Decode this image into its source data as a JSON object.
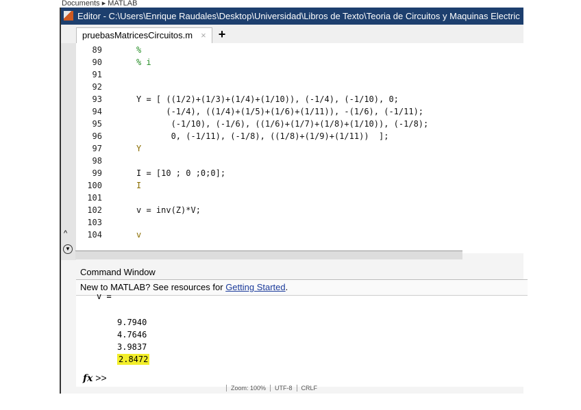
{
  "breadcrumb": [
    "Documents",
    "MATLAB"
  ],
  "title": "Editor - C:\\Users\\Enrique Raudales\\Desktop\\Universidad\\Libros de Texto\\Teoria de Circuitos y Maquinas Electric",
  "tab": {
    "label": "pruebasMatricesCircuitos.m",
    "close": "×",
    "add": "+"
  },
  "editor": {
    "lines": [
      {
        "n": "89",
        "text": "%",
        "kind": "comment"
      },
      {
        "n": "90",
        "text": "% i",
        "kind": "comment"
      },
      {
        "n": "91",
        "text": ""
      },
      {
        "n": "92",
        "text": ""
      },
      {
        "n": "93",
        "text": "Y = [ ((1/2)+(1/3)+(1/4)+(1/10)), (-1/4), (-1/10), 0;"
      },
      {
        "n": "94",
        "text": "      (-1/4), ((1/4)+(1/5)+(1/6)+(1/11)), -(1/6), (-1/11);"
      },
      {
        "n": "95",
        "text": "       (-1/10), (-1/6), ((1/6)+(1/7)+(1/8)+(1/10)), (-1/8);"
      },
      {
        "n": "96",
        "text": "       0, (-1/11), (-1/8), ((1/8)+(1/9)+(1/11))  ];"
      },
      {
        "n": "97",
        "text": "Y",
        "kind": "var"
      },
      {
        "n": "98",
        "text": ""
      },
      {
        "n": "99",
        "text": "I = [10 ; 0 ;0;0];"
      },
      {
        "n": "100",
        "text": "I",
        "kind": "var"
      },
      {
        "n": "101",
        "text": ""
      },
      {
        "n": "102",
        "text": "v = inv(Z)*V;"
      },
      {
        "n": "103",
        "text": ""
      },
      {
        "n": "104",
        "text": "v",
        "kind": "var"
      }
    ]
  },
  "command_window": {
    "title": "Command Window",
    "banner_text": "New to MATLAB? See resources for ",
    "banner_link": "Getting Started",
    "banner_end": ".",
    "var_header": "v =",
    "values": [
      "9.7940",
      "4.7646",
      "3.9837",
      "2.8472"
    ],
    "highlight_color": "#f2ee2a",
    "prompt": ">>",
    "fx": "fx"
  },
  "status": [
    "Zoom: 100%",
    "UTF-8",
    "CRLF"
  ]
}
